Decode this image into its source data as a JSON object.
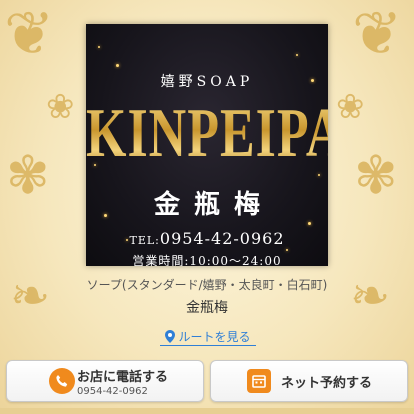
{
  "banner": {
    "sub_brand": "嬉野SOAP",
    "brand_en": "KINPEIPAI",
    "brand_jp": "金瓶梅",
    "tel_label": "TEL:",
    "tel_number": "0954-42-0962",
    "hours": "営業時間:10:00〜24:00"
  },
  "shop": {
    "category": "ソープ(スタンダード/嬉野・太良町・白石町)",
    "name": "金瓶梅"
  },
  "route_link": {
    "label": "ルートを見る",
    "icon": "map-pin-icon"
  },
  "actions": {
    "call": {
      "label": "お店に電話する",
      "phone": "0954-42-0962",
      "icon": "phone-icon"
    },
    "reserve": {
      "label": "ネット予約する",
      "icon": "calendar-icon"
    }
  },
  "colors": {
    "background": "#f7ecc6",
    "ornament": "#d9b25b",
    "banner_bg": "#17151c",
    "gold": "#d4a843",
    "link": "#2f7fd6",
    "icon_orange": "#f08a1d"
  }
}
